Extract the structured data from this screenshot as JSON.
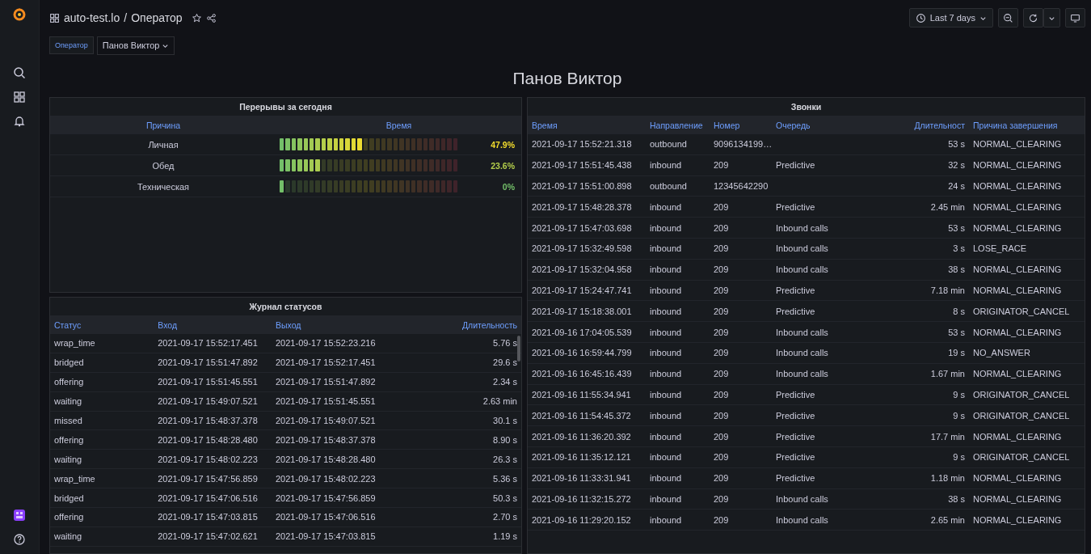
{
  "topbar": {
    "folder": "auto-test.lo",
    "separator": "/",
    "title": "Оператор",
    "time_range": "Last 7 days"
  },
  "variables": [
    {
      "label": "Оператор",
      "value": "Панов Виктор"
    }
  ],
  "heading": "Панов Виктор",
  "breaks_panel": {
    "title": "Перерывы за сегодня",
    "columns": [
      "Причина",
      "Время"
    ],
    "rows": [
      {
        "reason": "Личная",
        "level": 0.479,
        "value": "47.9%"
      },
      {
        "reason": "Обед",
        "level": 0.236,
        "value": "23.6%"
      },
      {
        "reason": "Техническая",
        "level": 0,
        "value": "0%"
      }
    ]
  },
  "status_panel": {
    "title": "Журнал статусов",
    "columns": [
      "Статус",
      "Вход",
      "Выход",
      "Длительность"
    ],
    "rows": [
      [
        "wrap_time",
        "2021-09-17 15:52:17.451",
        "2021-09-17 15:52:23.216",
        "5.76 s"
      ],
      [
        "bridged",
        "2021-09-17 15:51:47.892",
        "2021-09-17 15:52:17.451",
        "29.6 s"
      ],
      [
        "offering",
        "2021-09-17 15:51:45.551",
        "2021-09-17 15:51:47.892",
        "2.34 s"
      ],
      [
        "waiting",
        "2021-09-17 15:49:07.521",
        "2021-09-17 15:51:45.551",
        "2.63 min"
      ],
      [
        "missed",
        "2021-09-17 15:48:37.378",
        "2021-09-17 15:49:07.521",
        "30.1 s"
      ],
      [
        "offering",
        "2021-09-17 15:48:28.480",
        "2021-09-17 15:48:37.378",
        "8.90 s"
      ],
      [
        "waiting",
        "2021-09-17 15:48:02.223",
        "2021-09-17 15:48:28.480",
        "26.3 s"
      ],
      [
        "wrap_time",
        "2021-09-17 15:47:56.859",
        "2021-09-17 15:48:02.223",
        "5.36 s"
      ],
      [
        "bridged",
        "2021-09-17 15:47:06.516",
        "2021-09-17 15:47:56.859",
        "50.3 s"
      ],
      [
        "offering",
        "2021-09-17 15:47:03.815",
        "2021-09-17 15:47:06.516",
        "2.70 s"
      ],
      [
        "waiting",
        "2021-09-17 15:47:02.621",
        "2021-09-17 15:47:03.815",
        "1.19 s"
      ]
    ]
  },
  "calls_panel": {
    "title": "Звонки",
    "columns": [
      "Время",
      "Направление",
      "Номер",
      "Очередь",
      "Длительност",
      "Причина завершения"
    ],
    "rows": [
      [
        "2021-09-17 15:52:21.318",
        "outbound",
        "9096134199…",
        "",
        "53 s",
        "NORMAL_CLEARING"
      ],
      [
        "2021-09-17 15:51:45.438",
        "inbound",
        "209",
        "Predictive",
        "32 s",
        "NORMAL_CLEARING"
      ],
      [
        "2021-09-17 15:51:00.898",
        "outbound",
        "12345642290",
        "",
        "24 s",
        "NORMAL_CLEARING"
      ],
      [
        "2021-09-17 15:48:28.378",
        "inbound",
        "209",
        "Predictive",
        "2.45 min",
        "NORMAL_CLEARING"
      ],
      [
        "2021-09-17 15:47:03.698",
        "inbound",
        "209",
        "Inbound calls",
        "53 s",
        "NORMAL_CLEARING"
      ],
      [
        "2021-09-17 15:32:49.598",
        "inbound",
        "209",
        "Inbound calls",
        "3 s",
        "LOSE_RACE"
      ],
      [
        "2021-09-17 15:32:04.958",
        "inbound",
        "209",
        "Inbound calls",
        "38 s",
        "NORMAL_CLEARING"
      ],
      [
        "2021-09-17 15:24:47.741",
        "inbound",
        "209",
        "Predictive",
        "7.18 min",
        "NORMAL_CLEARING"
      ],
      [
        "2021-09-17 15:18:38.001",
        "inbound",
        "209",
        "Predictive",
        "8 s",
        "ORIGINATOR_CANCEL"
      ],
      [
        "2021-09-16 17:04:05.539",
        "inbound",
        "209",
        "Inbound calls",
        "53 s",
        "NORMAL_CLEARING"
      ],
      [
        "2021-09-16 16:59:44.799",
        "inbound",
        "209",
        "Inbound calls",
        "19 s",
        "NO_ANSWER"
      ],
      [
        "2021-09-16 16:45:16.439",
        "inbound",
        "209",
        "Inbound calls",
        "1.67 min",
        "NORMAL_CLEARING"
      ],
      [
        "2021-09-16 11:55:34.941",
        "inbound",
        "209",
        "Predictive",
        "9 s",
        "ORIGINATOR_CANCEL"
      ],
      [
        "2021-09-16 11:54:45.372",
        "inbound",
        "209",
        "Predictive",
        "9 s",
        "ORIGINATOR_CANCEL"
      ],
      [
        "2021-09-16 11:36:20.392",
        "inbound",
        "209",
        "Predictive",
        "17.7 min",
        "NORMAL_CLEARING"
      ],
      [
        "2021-09-16 11:35:12.121",
        "inbound",
        "209",
        "Predictive",
        "9 s",
        "ORIGINATOR_CANCEL"
      ],
      [
        "2021-09-16 11:33:31.941",
        "inbound",
        "209",
        "Predictive",
        "1.18 min",
        "NORMAL_CLEARING"
      ],
      [
        "2021-09-16 11:32:15.272",
        "inbound",
        "209",
        "Inbound calls",
        "38 s",
        "NORMAL_CLEARING"
      ],
      [
        "2021-09-16 11:29:20.152",
        "inbound",
        "209",
        "Inbound calls",
        "2.65 min",
        "NORMAL_CLEARING"
      ]
    ]
  }
}
